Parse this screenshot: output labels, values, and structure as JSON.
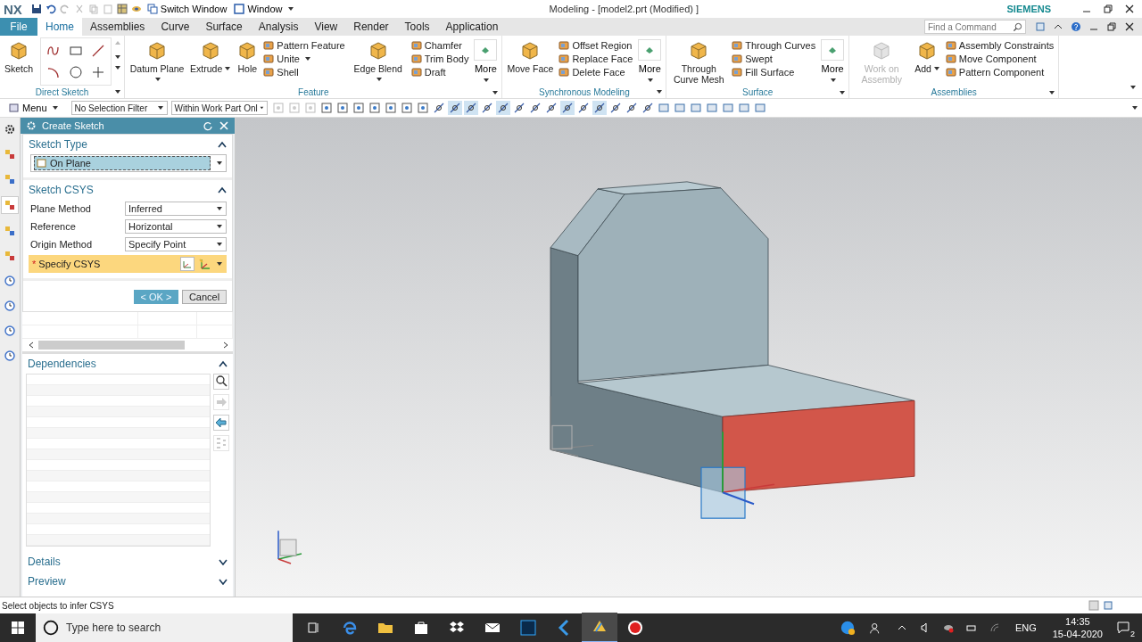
{
  "title_bar": {
    "logo": "NX",
    "switch_window": "Switch Window",
    "window_menu": "Window",
    "title": "Modeling - [model2.prt (Modified) ]",
    "brand": "SIEMENS"
  },
  "file_tab": "File",
  "tabs": [
    {
      "label": "Home",
      "selected": true
    },
    {
      "label": "Assemblies",
      "selected": false
    },
    {
      "label": "Curve",
      "selected": false
    },
    {
      "label": "Surface",
      "selected": false
    },
    {
      "label": "Analysis",
      "selected": false
    },
    {
      "label": "View",
      "selected": false
    },
    {
      "label": "Render",
      "selected": false
    },
    {
      "label": "Tools",
      "selected": false
    },
    {
      "label": "Application",
      "selected": false
    }
  ],
  "command_search": {
    "placeholder": "Find a Command"
  },
  "ribbon": [
    {
      "name": "Direct Sketch",
      "items": [
        {
          "kind": "large",
          "label": "Sketch",
          "dropdown": false,
          "disabled": false
        },
        {
          "kind": "sketch-tools"
        }
      ]
    },
    {
      "name": "Feature",
      "items": [
        {
          "kind": "large",
          "label": "Datum Plane",
          "dropdown": true,
          "disabled": false
        },
        {
          "kind": "large",
          "label": "Extrude",
          "dropdown": true,
          "disabled": false
        },
        {
          "kind": "large",
          "label": "Hole",
          "dropdown": false,
          "disabled": false
        },
        {
          "kind": "column",
          "entries": [
            {
              "label": "Pattern Feature",
              "dropdown": false
            },
            {
              "label": "Unite",
              "dropdown": true
            },
            {
              "label": "Shell",
              "dropdown": false
            }
          ]
        },
        {
          "kind": "large",
          "label": "Edge Blend",
          "dropdown": true,
          "disabled": false
        },
        {
          "kind": "column",
          "entries": [
            {
              "label": "Chamfer",
              "dropdown": false
            },
            {
              "label": "Trim Body",
              "dropdown": false
            },
            {
              "label": "Draft",
              "dropdown": false
            }
          ]
        },
        {
          "kind": "more",
          "label": "More"
        }
      ]
    },
    {
      "name": "Synchronous Modeling",
      "items": [
        {
          "kind": "large",
          "label": "Move Face",
          "dropdown": false,
          "disabled": false
        },
        {
          "kind": "column",
          "entries": [
            {
              "label": "Offset Region",
              "dropdown": false
            },
            {
              "label": "Replace Face",
              "dropdown": false
            },
            {
              "label": "Delete Face",
              "dropdown": false
            }
          ]
        },
        {
          "kind": "more",
          "label": "More"
        }
      ]
    },
    {
      "name": "Surface",
      "items": [
        {
          "kind": "large",
          "label": "Through Curve Mesh",
          "dropdown": false,
          "disabled": false
        },
        {
          "kind": "column",
          "entries": [
            {
              "label": "Through Curves",
              "dropdown": false
            },
            {
              "label": "Swept",
              "dropdown": false
            },
            {
              "label": "Fill Surface",
              "dropdown": false
            }
          ]
        },
        {
          "kind": "more",
          "label": "More"
        }
      ]
    },
    {
      "name": "Assemblies",
      "items": [
        {
          "kind": "large",
          "label": "Work on Assembly",
          "dropdown": false,
          "disabled": true
        },
        {
          "kind": "large",
          "label": "Add",
          "dropdown": true,
          "disabled": false
        },
        {
          "kind": "column",
          "entries": [
            {
              "label": "Assembly Constraints",
              "dropdown": false
            },
            {
              "label": "Move Component",
              "dropdown": false
            },
            {
              "label": "Pattern Component",
              "dropdown": false
            }
          ]
        }
      ]
    }
  ],
  "toolbar": {
    "menu": "Menu",
    "filters": [
      "No Selection Filter",
      "Within Work Part Onl"
    ]
  },
  "dialog": {
    "title": "Create Sketch",
    "type_section": {
      "title": "Sketch Type",
      "expanded": true,
      "value": "On Plane"
    },
    "csys_section": {
      "title": "Sketch CSYS",
      "expanded": true,
      "fields": [
        {
          "label": "Plane Method",
          "value": "Inferred"
        },
        {
          "label": "Reference",
          "value": "Horizontal"
        },
        {
          "label": "Origin Method",
          "value": "Specify Point"
        }
      ],
      "required_mark": "*",
      "required_label": "Specify CSYS"
    },
    "buttons": [
      {
        "label": "< OK >",
        "kind": "primary"
      },
      {
        "label": "Cancel",
        "kind": "secondary"
      }
    ],
    "panels": [
      {
        "title": "Dependencies",
        "expanded": true
      },
      {
        "title": "Details",
        "expanded": false
      },
      {
        "title": "Preview",
        "expanded": false
      }
    ]
  },
  "status_bar": "Select objects to infer CSYS",
  "taskbar": {
    "search_placeholder": "Type here to search",
    "language": "ENG",
    "time": "14:35",
    "date": "15-04-2020",
    "notifications": "2"
  }
}
